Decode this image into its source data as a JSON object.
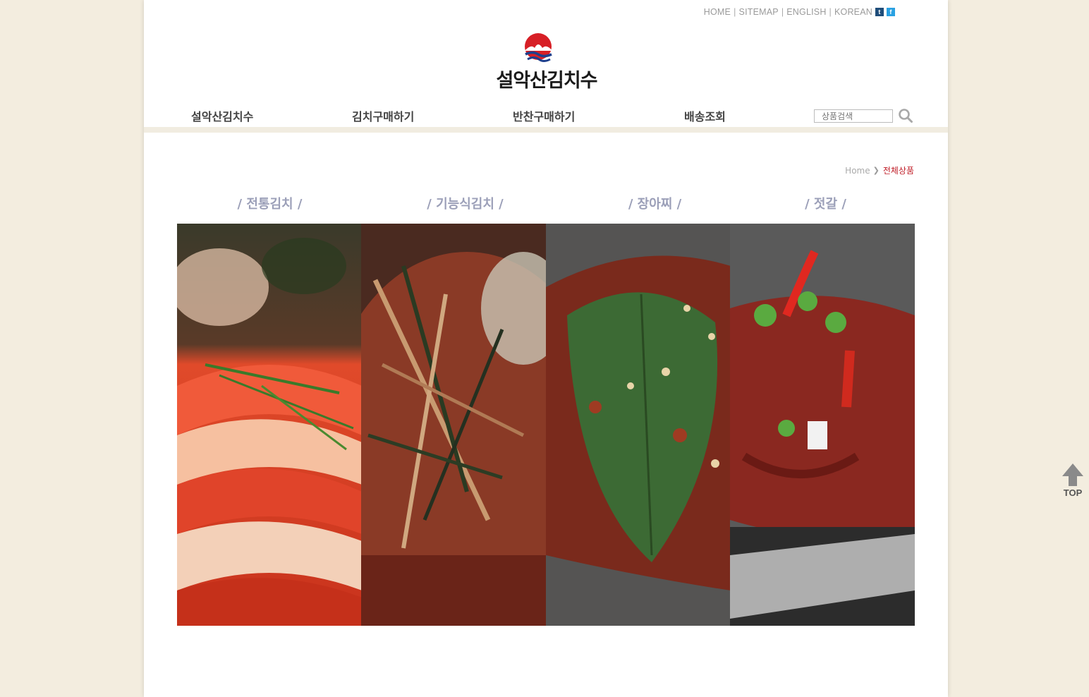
{
  "header": {
    "top_links": [
      "HOME",
      "SITEMAP",
      "ENGLISH",
      "KOREAN"
    ],
    "sns": [
      "t",
      "f"
    ],
    "logo_text": "설악산김치수"
  },
  "nav": {
    "items": [
      "설악산김치수",
      "김치구매하기",
      "반찬구매하기",
      "배송조회"
    ],
    "search_placeholder": "상품검색"
  },
  "breadcrumb": {
    "home": "Home",
    "current": "전체상품"
  },
  "categories": [
    {
      "title": "/ 전통김치 /"
    },
    {
      "title": "/ 기능식김치 /"
    },
    {
      "title": "/ 장아찌 /"
    },
    {
      "title": "/ 젓갈 /"
    }
  ],
  "top_button": {
    "label": "TOP"
  },
  "colors": {
    "background": "#f3eddf",
    "accent_red": "#c0202a",
    "category_title": "#9b9fb8"
  }
}
